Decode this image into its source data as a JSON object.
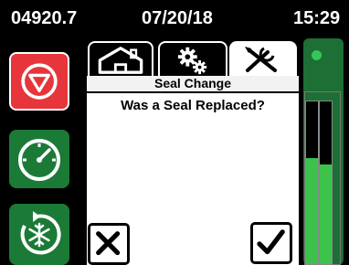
{
  "status": {
    "hours": "04920.7",
    "date": "07/20/18",
    "time": "15:29"
  },
  "tabs": [
    {
      "icon": "home-icon"
    },
    {
      "icon": "gears-icon"
    },
    {
      "icon": "tools-icon",
      "active": true
    }
  ],
  "panel": {
    "title": "Seal Change",
    "question": "Was a Seal Replaced?"
  },
  "left_buttons": [
    {
      "icon": "stop-icon",
      "color": "#e6363b"
    },
    {
      "icon": "speedometer-icon",
      "color": "#1c7a37"
    },
    {
      "icon": "defrost-icon",
      "color": "#1c7a37"
    }
  ],
  "actions": {
    "cancel_icon": "x-icon",
    "confirm_icon": "checkmark-icon"
  },
  "gauges": {
    "left_level": 0.65,
    "right_level": 0.61,
    "fill_color": "#3cc24a",
    "indicator_color": "#34c759"
  },
  "colors": {
    "background": "#000000",
    "panel": "#ffffff",
    "accent_red": "#e6363b",
    "accent_green": "#1c7a37"
  }
}
